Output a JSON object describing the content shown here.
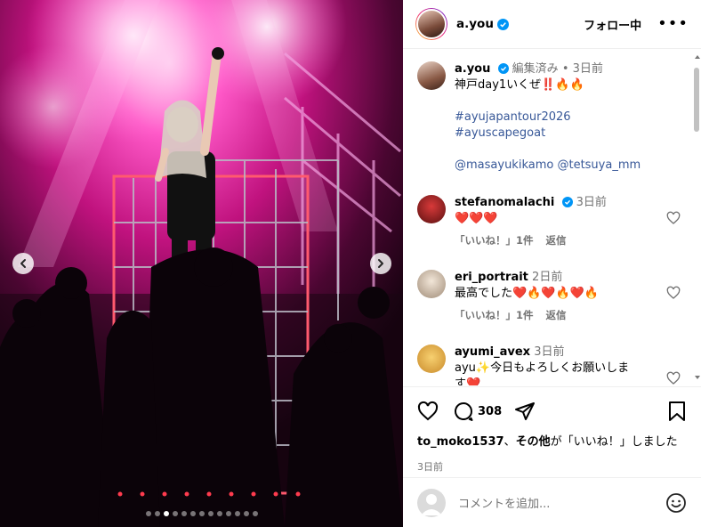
{
  "post": {
    "username": "a.you",
    "follow_label": "フォロー中",
    "more": "•••"
  },
  "caption": {
    "username": "a.you",
    "edited": "編集済み",
    "sep": "•",
    "time": "3日前",
    "text": "神戸day1いくぜ‼️🔥🔥",
    "hashtag1": "#ayujapantour2026",
    "hashtag2": "#ayuscapegoat",
    "mention1": "@masayukikamo",
    "mention2": "@tetsuya_mm"
  },
  "comments": [
    {
      "user": "stefanomalachi",
      "verified": true,
      "time": "3日前",
      "text": "❤️❤️❤️",
      "likes": "「いいね！」1件",
      "reply": "返信"
    },
    {
      "user": "eri_portrait",
      "verified": false,
      "time": "2日前",
      "text": "最高でした❤️🔥❤️🔥❤️🔥",
      "likes": "「いいね！」1件",
      "reply": "返信"
    },
    {
      "user": "ayumi_avex",
      "verified": false,
      "time": "3日前",
      "text": "ayu✨今日もよろしくお願いしま",
      "text2": "す❤️",
      "likes": "",
      "reply": ""
    }
  ],
  "actions": {
    "comment_count": "308",
    "liked_by_user": "to_moko1537",
    "liked_by_mid": "、",
    "liked_by_others": "その他",
    "liked_by_suffix": "が「いいね！」しました",
    "time": "3日前"
  },
  "comment_input": {
    "placeholder": "コメントを追加..."
  },
  "carousel": {
    "total": 13,
    "active": 2
  },
  "colors": {
    "verified": "#0095f6",
    "link": "#385898",
    "stage_pink": "#e0188f"
  }
}
